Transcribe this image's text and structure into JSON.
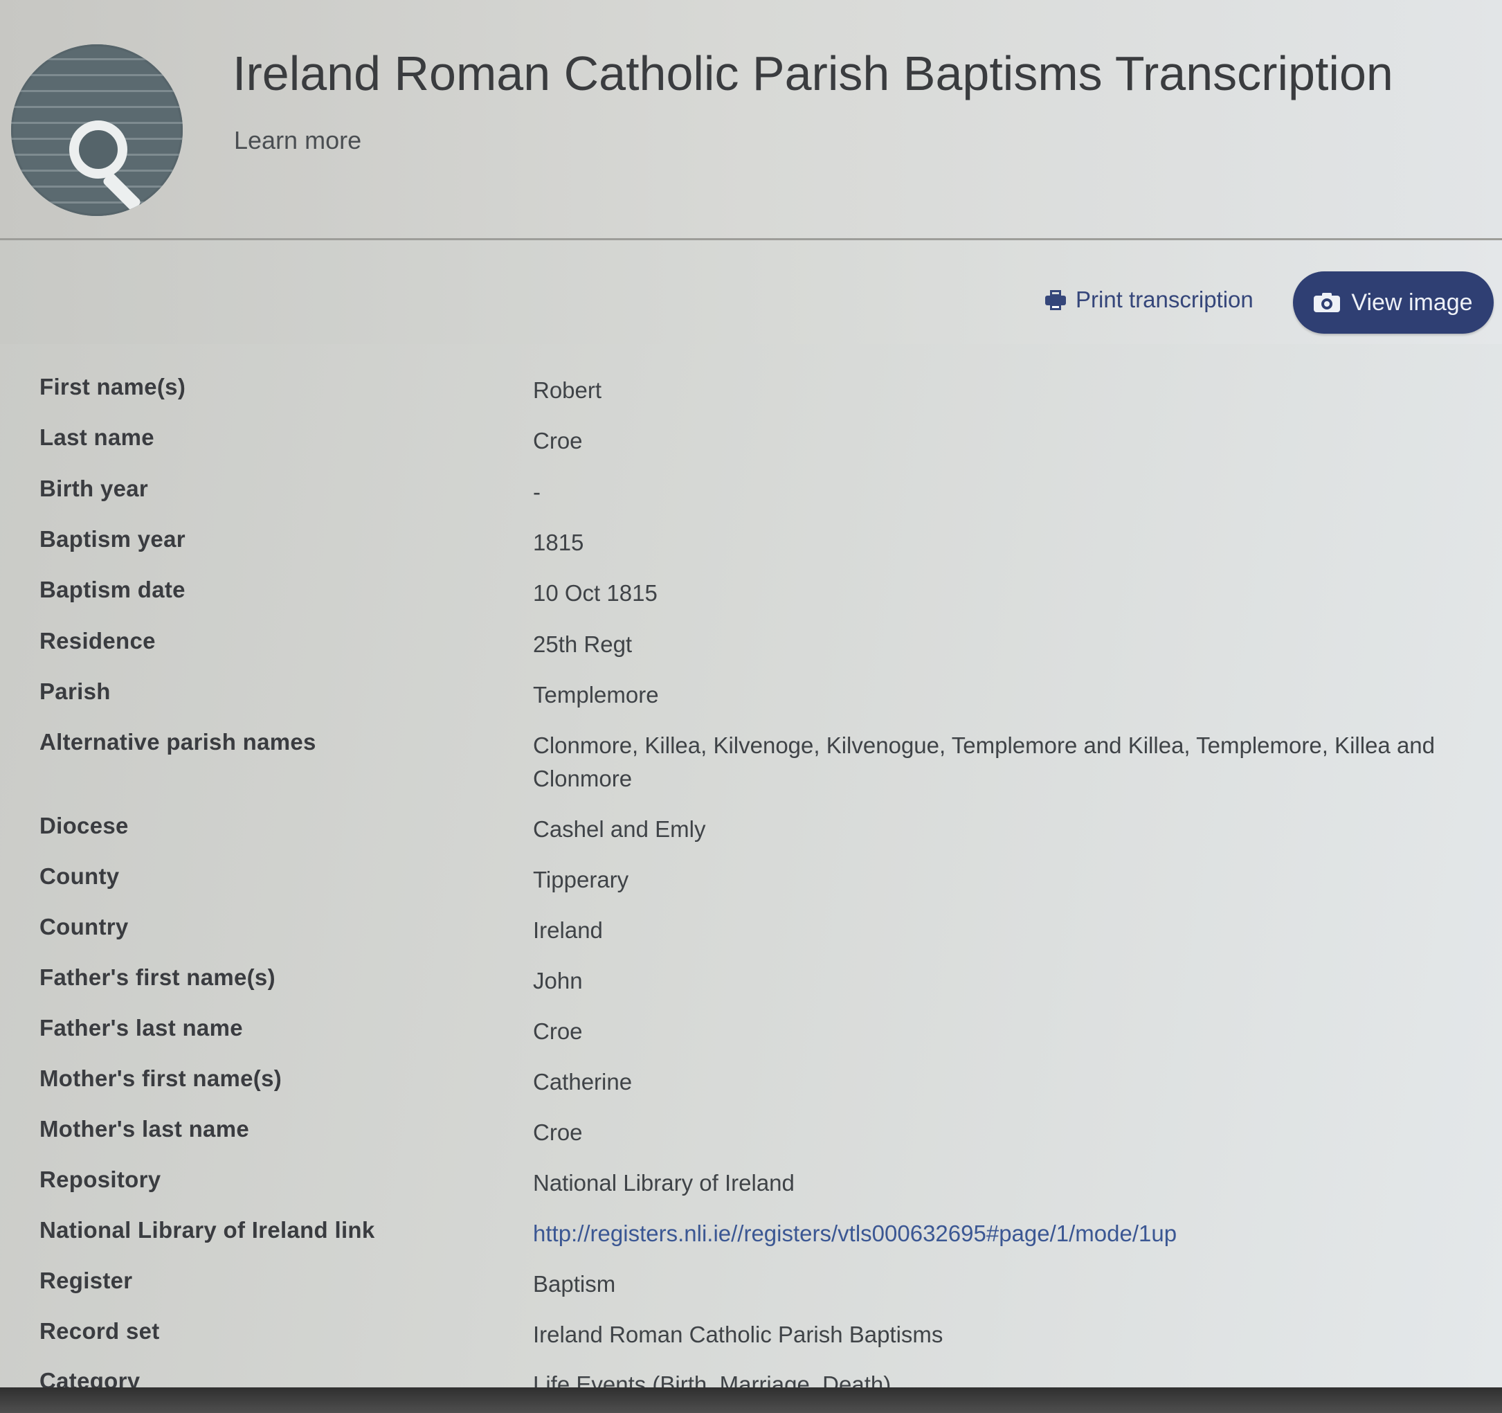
{
  "header": {
    "title": "Ireland Roman Catholic Parish Baptisms Transcription",
    "learn_more": "Learn more"
  },
  "actions": {
    "print_label": "Print transcription",
    "view_label": "View image",
    "accent_color": "#2f3f73"
  },
  "record": [
    {
      "label": "First name(s)",
      "value": "Robert"
    },
    {
      "label": "Last name",
      "value": "Croe"
    },
    {
      "label": "Birth year",
      "value": "-"
    },
    {
      "label": "Baptism year",
      "value": "1815"
    },
    {
      "label": "Baptism date",
      "value": "10 Oct 1815"
    },
    {
      "label": "Residence",
      "value": "25th Regt"
    },
    {
      "label": "Parish",
      "value": "Templemore"
    },
    {
      "label": "Alternative parish names",
      "value": "Clonmore, Killea, Kilvenoge, Kilvenogue, Templemore and Killea, Templemore, Killea and Clonmore"
    },
    {
      "label": "Diocese",
      "value": "Cashel and Emly"
    },
    {
      "label": "County",
      "value": "Tipperary"
    },
    {
      "label": "Country",
      "value": "Ireland"
    },
    {
      "label": "Father's first name(s)",
      "value": "John"
    },
    {
      "label": "Father's last name",
      "value": "Croe"
    },
    {
      "label": "Mother's first name(s)",
      "value": "Catherine"
    },
    {
      "label": "Mother's last name",
      "value": "Croe"
    },
    {
      "label": "Repository",
      "value": "National Library of Ireland"
    },
    {
      "label": "National Library of Ireland link",
      "value": "http://registers.nli.ie//registers/vtls000632695#page/1/mode/1up"
    },
    {
      "label": "Register",
      "value": "Baptism"
    },
    {
      "label": "Record set",
      "value": "Ireland Roman Catholic Parish Baptisms"
    },
    {
      "label": "Category",
      "value": "Life Events (Birth, Marriage, Death)"
    }
  ]
}
